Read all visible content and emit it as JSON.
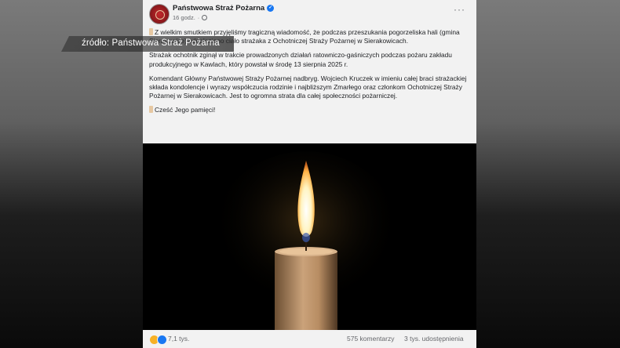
{
  "post": {
    "page_name": "Państwowa Straż Pożarna",
    "timestamp": "16 godz.",
    "separator": "·",
    "more_label": "···",
    "paragraphs": [
      "Z wielkim smutkiem przyjęliśmy tragiczną wiadomość, że podczas przeszukania pogorzeliska hali (gmina Sierakowice) odnaleziono ciało strażaka z Ochotniczej Straży Pożarnej w Sierakowicach.",
      "Strażak ochotnik zginął w trakcie prowadzonych działań ratowniczo-gaśniczych podczas pożaru zakładu produkcyjnego w Kawlach, który powstał w środę 13 sierpnia 2025 r.",
      "Komendant Główny Państwowej Straży Pożarnej nadbryg. Wojciech Kruczek w imieniu całej braci strażackiej składa kondolencje i wyrazy współczucia rodzinie i najbliższym Zmarłego oraz członkom Ochotniczej Straży Pożarnej w Sierakowicach. Jest to ogromna strata dla całej społeczności pożarniczej.",
      "Cześć Jego pamięci!"
    ],
    "reaction_count": "7,1 tys.",
    "comments": "575 komentarzy",
    "shares": "3 tys. udostępnienia"
  },
  "overlay": {
    "source_label": "źródło: Państwowa Straż Pożarna"
  },
  "colors": {
    "facebook_blue": "#1877f2",
    "post_background": "#f2f2f2",
    "flame": "#fff4c2",
    "candle": "#c9a27a"
  },
  "icons": [
    "avatar",
    "verified-icon",
    "globe-icon",
    "more-icon",
    "candle-emoji",
    "sad-reaction-icon",
    "like-reaction-icon"
  ]
}
